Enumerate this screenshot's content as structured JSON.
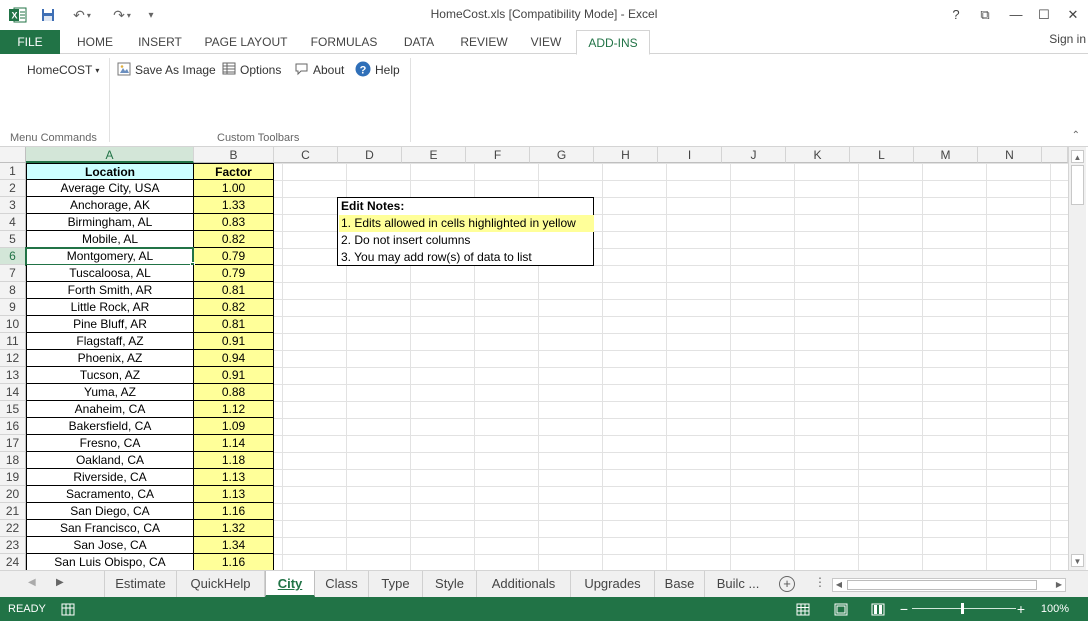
{
  "window": {
    "title": "HomeCost.xls  [Compatibility Mode] - Excel",
    "help": "?",
    "restore": "⧉",
    "minimize": "—",
    "maximize": "☐",
    "close": "✕"
  },
  "ribbon": {
    "tabs": [
      "FILE",
      "HOME",
      "INSERT",
      "PAGE LAYOUT",
      "FORMULAS",
      "DATA",
      "REVIEW",
      "VIEW",
      "ADD-INS"
    ],
    "active_tab": "ADD-INS",
    "sign_in": "Sign in",
    "homecost_menu": "HomeCOST",
    "save_as_image": "Save As Image",
    "options": "Options",
    "about": "About",
    "help": "Help",
    "group_menu_commands": "Menu Commands",
    "group_custom_toolbars": "Custom Toolbars"
  },
  "columns": [
    "A",
    "B",
    "C",
    "D",
    "E",
    "F",
    "G",
    "H",
    "I",
    "J",
    "K",
    "L",
    "M",
    "N"
  ],
  "selected_column": "A",
  "selected_row": "6",
  "table": {
    "header_location": "Location",
    "header_factor": "Factor",
    "rows": [
      {
        "row": "1",
        "location": "",
        "factor": ""
      },
      {
        "row": "2",
        "location": "Average City, USA",
        "factor": "1.00"
      },
      {
        "row": "3",
        "location": "Anchorage, AK",
        "factor": "1.33"
      },
      {
        "row": "4",
        "location": "Birmingham, AL",
        "factor": "0.83"
      },
      {
        "row": "5",
        "location": "Mobile, AL",
        "factor": "0.82"
      },
      {
        "row": "6",
        "location": "Montgomery, AL",
        "factor": "0.79"
      },
      {
        "row": "7",
        "location": "Tuscaloosa, AL",
        "factor": "0.79"
      },
      {
        "row": "8",
        "location": "Forth Smith, AR",
        "factor": "0.81"
      },
      {
        "row": "9",
        "location": "Little Rock, AR",
        "factor": "0.82"
      },
      {
        "row": "10",
        "location": "Pine Bluff, AR",
        "factor": "0.81"
      },
      {
        "row": "11",
        "location": "Flagstaff, AZ",
        "factor": "0.91"
      },
      {
        "row": "12",
        "location": "Phoenix, AZ",
        "factor": "0.94"
      },
      {
        "row": "13",
        "location": "Tucson, AZ",
        "factor": "0.91"
      },
      {
        "row": "14",
        "location": "Yuma, AZ",
        "factor": "0.88"
      },
      {
        "row": "15",
        "location": "Anaheim, CA",
        "factor": "1.12"
      },
      {
        "row": "16",
        "location": "Bakersfield, CA",
        "factor": "1.09"
      },
      {
        "row": "17",
        "location": "Fresno, CA",
        "factor": "1.14"
      },
      {
        "row": "18",
        "location": "Oakland, CA",
        "factor": "1.18"
      },
      {
        "row": "19",
        "location": "Riverside, CA",
        "factor": "1.13"
      },
      {
        "row": "20",
        "location": "Sacramento, CA",
        "factor": "1.13"
      },
      {
        "row": "21",
        "location": "San Diego, CA",
        "factor": "1.16"
      },
      {
        "row": "22",
        "location": "San Francisco, CA",
        "factor": "1.32"
      },
      {
        "row": "23",
        "location": "San Jose, CA",
        "factor": "1.34"
      },
      {
        "row": "24",
        "location": "San Luis Obispo, CA",
        "factor": "1.16"
      }
    ]
  },
  "notes": {
    "title": "Edit Notes:",
    "line1": "1. Edits allowed in cells highlighted in yellow",
    "line2": "2. Do not insert columns",
    "line3": "3. You may add row(s) of data to list"
  },
  "sheet_tabs": [
    "Estimate",
    "QuickHelp",
    "City",
    "Class",
    "Type",
    "Style",
    "Additionals",
    "Upgrades",
    "Base",
    "Builc ..."
  ],
  "active_sheet": "City",
  "status": {
    "ready": "READY",
    "zoom": "100%",
    "zoom_level_percent": 100
  },
  "colors": {
    "excel_green": "#217346",
    "highlight_yellow": "#ffff99",
    "header_cyan": "#ccffff"
  }
}
